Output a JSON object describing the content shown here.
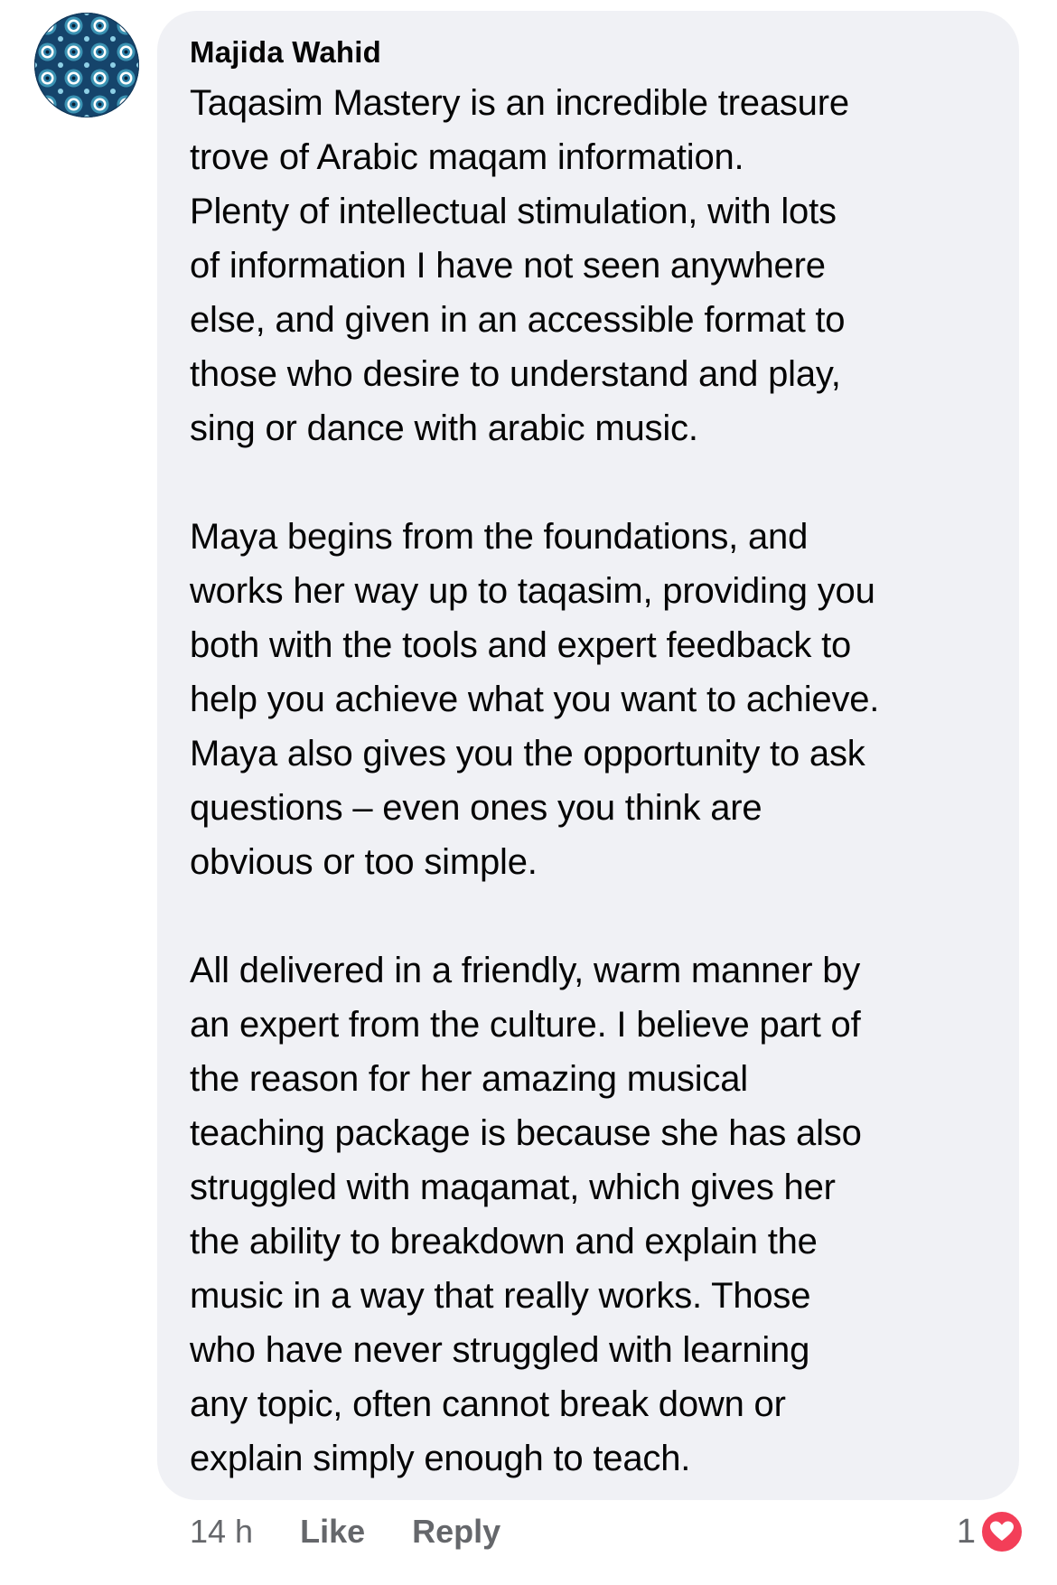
{
  "comment": {
    "author": "Majida Wahid",
    "avatar_icon": "patterned-avatar-icon",
    "paragraphs": [
      "Taqasim Mastery is  an incredible treasure\ntrove of Arabic maqam information.\nPlenty of intellectual stimulation, with lots\nof information I have not seen anywhere\nelse, and given in an accessible format to\nthose who desire to understand and play,\nsing or dance with arabic music.",
      "Maya begins from the foundations, and\nworks her way up to taqasim, providing you\nboth with the tools and expert feedback to\nhelp you achieve what you want to achieve.\nMaya also gives you the opportunity to ask\nquestions – even ones you think are\nobvious or too simple.",
      "All delivered in a friendly, warm manner by\nan expert from the culture.  I believe part of\nthe reason for her amazing musical\nteaching package is because she has also\nstruggled with maqamat, which gives her\nthe ability to breakdown and explain the\nmusic in a way that really works.  Those\nwho have never struggled with learning\nany topic, often cannot break down or\nexplain simply enough to teach."
    ]
  },
  "actions": {
    "time": "14 h",
    "like_label": "Like",
    "reply_label": "Reply"
  },
  "reactions": {
    "count": "1",
    "icon": "heart-icon",
    "color": "#f33e58"
  },
  "colors": {
    "bubble": "#f0f1f5",
    "meta_text": "#65676b",
    "text": "#050505"
  }
}
